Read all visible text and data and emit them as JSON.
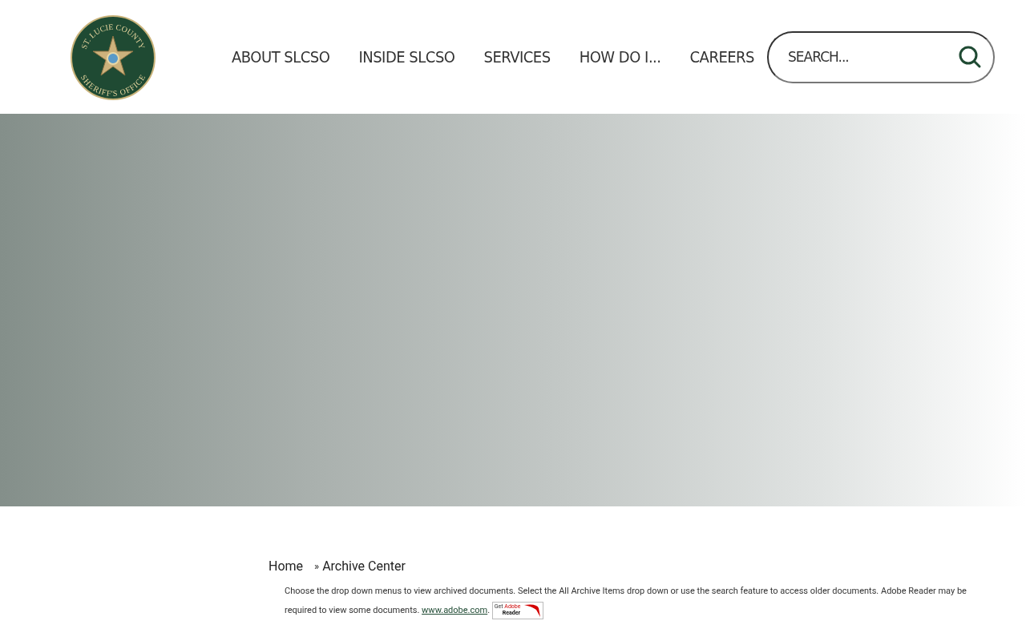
{
  "header": {
    "logo": {
      "top_text": "ST. LUCIE COUNTY",
      "bottom_text": "SHERIFF'S OFFICE"
    },
    "nav": [
      {
        "label": "ABOUT SLCSO"
      },
      {
        "label": "INSIDE SLCSO"
      },
      {
        "label": "SERVICES"
      },
      {
        "label": "HOW DO I..."
      },
      {
        "label": "CAREERS"
      }
    ],
    "search": {
      "placeholder": "SEARCH..."
    }
  },
  "breadcrumb": [
    {
      "label": "Home"
    },
    {
      "label": "Archive Center"
    }
  ],
  "breadcrumb_separator": "»",
  "intro": {
    "text": "Choose the drop down menus to view archived documents. Select the All Archive Items drop down or use the search feature to access older documents. Adobe Reader may be required to view some documents. ",
    "link": "www.adobe.com",
    "after_link": ".",
    "badge": {
      "line_1": "Get",
      "line_2": "Adobe",
      "line_3": "Reader"
    }
  }
}
